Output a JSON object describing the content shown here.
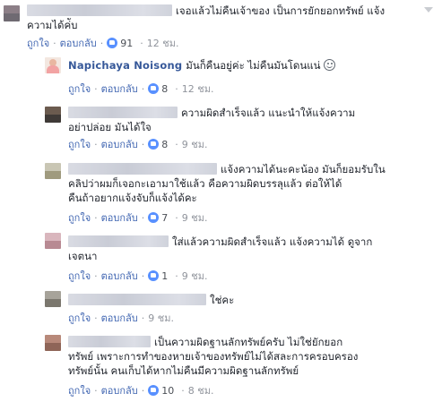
{
  "labels": {
    "like": "ถูกใจ",
    "reply": "ตอบกลับ",
    "separator": "·"
  },
  "comments": [
    {
      "text_lines": [
        "เจอแล้วไม่คืนเจ้าของ เป็นการยักยอกทรัพย์ แจ้ง",
        "ความได้ค่ับ"
      ],
      "likes": "91",
      "time": "12 ชม."
    },
    {
      "author": "Napichaya Noisong",
      "text": "มันก็คืนอยู่ค่ะ ไม่คืนมันโดนแน่",
      "likes": "8",
      "time": "12 ชม."
    },
    {
      "text_lines": [
        "ความผิดสำเร็จแล้ว แนะนำให้แจ้งความ",
        "อย่าปล่อย มันได้ใจ"
      ],
      "likes": "8",
      "time": "9 ชม."
    },
    {
      "text_lines": [
        "แจ้งความได้นะคะน้อง มันก็ยอมรับใน",
        "คลิปว่าผมก็เจอกะเอามาใช้แล้ว คือความผิดบรรลุแล้ว ต่อให้ได้",
        "คืนถ้าอยากแจ้งจับก็แจ้งได้คะ"
      ],
      "likes": "7",
      "time": "9 ชม."
    },
    {
      "text_lines": [
        "ใส่แล้วความผิดสำเร็จแล้ว แจ้งความได้ ดูจาก",
        "เจตนา"
      ],
      "likes": "1",
      "time": "9 ชม."
    },
    {
      "text_lines": [
        "ใช่คะ"
      ],
      "likes": "",
      "time": "9 ชม."
    },
    {
      "text_lines": [
        "เป็นความผิดฐานลักทรัพย์ครับ ไม่ใช่ยักยอก",
        "ทรัพย์ เพราะการทำของหายเจ้าของทรัพย์ไม่ได้สละการครอบครอง",
        "ทรัพย์นั้น คนเก็บได้หากไม่คืนมีความผิดฐานลักทรัพย์"
      ],
      "likes": "10",
      "time": "8 ชม."
    }
  ]
}
